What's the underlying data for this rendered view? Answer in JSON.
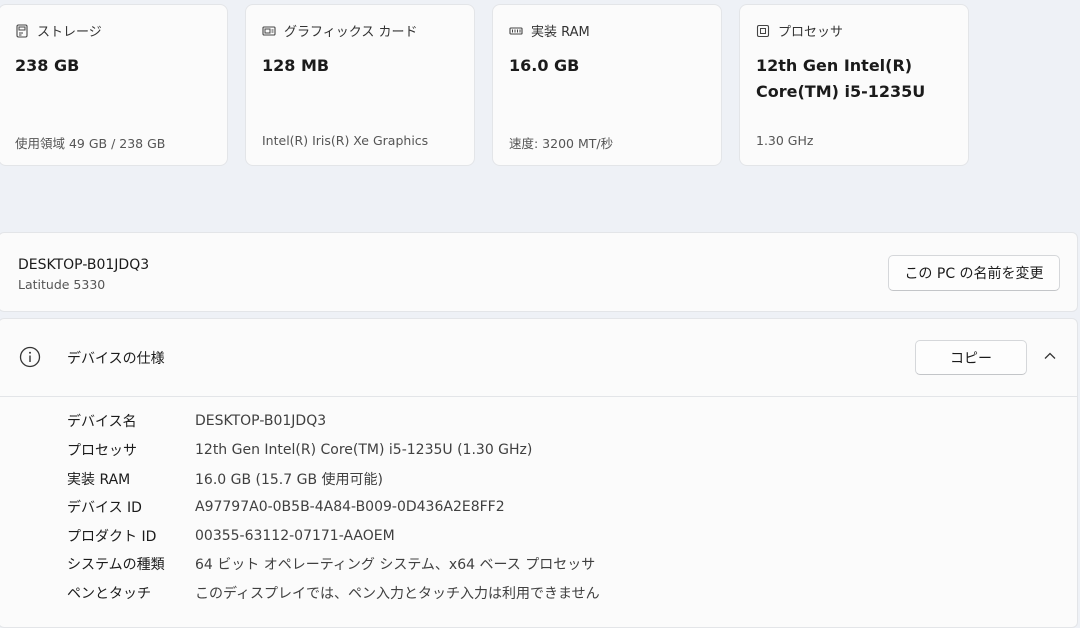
{
  "cards": [
    {
      "title": "ストレージ",
      "icon": "storage-icon",
      "value": "238 GB",
      "sub": "使用領域 49 GB / 238 GB"
    },
    {
      "title": "グラフィックス カード",
      "icon": "graphics-card-icon",
      "value": "128 MB",
      "sub": "Intel(R) Iris(R) Xe Graphics"
    },
    {
      "title": "実装 RAM",
      "icon": "ram-icon",
      "value": "16.0 GB",
      "sub": "速度: 3200 MT/秒"
    },
    {
      "title": "プロセッサ",
      "icon": "processor-icon",
      "value": "12th Gen Intel(R) Core(TM) i5-1235U",
      "sub": "1.30 GHz"
    }
  ],
  "device": {
    "name": "DESKTOP-B01JDQ3",
    "model": "Latitude 5330",
    "rename_label": "この PC の名前を変更"
  },
  "specs": {
    "title": "デバイスの仕様",
    "copy_label": "コピー",
    "rows": [
      {
        "key": "デバイス名",
        "value": "DESKTOP-B01JDQ3"
      },
      {
        "key": "プロセッサ",
        "value": "12th Gen Intel(R) Core(TM) i5-1235U (1.30 GHz)"
      },
      {
        "key": "実装 RAM",
        "value": "16.0 GB (15.7 GB 使用可能)"
      },
      {
        "key": "デバイス ID",
        "value": "A97797A0-0B5B-4A84-B009-0D436A2E8FF2"
      },
      {
        "key": "プロダクト ID",
        "value": "00355-63112-07171-AAOEM"
      },
      {
        "key": "システムの種類",
        "value": "64 ビット オペレーティング システム、x64 ベース プロセッサ"
      },
      {
        "key": "ペンとタッチ",
        "value": "このディスプレイでは、ペン入力とタッチ入力は利用できません"
      }
    ]
  }
}
